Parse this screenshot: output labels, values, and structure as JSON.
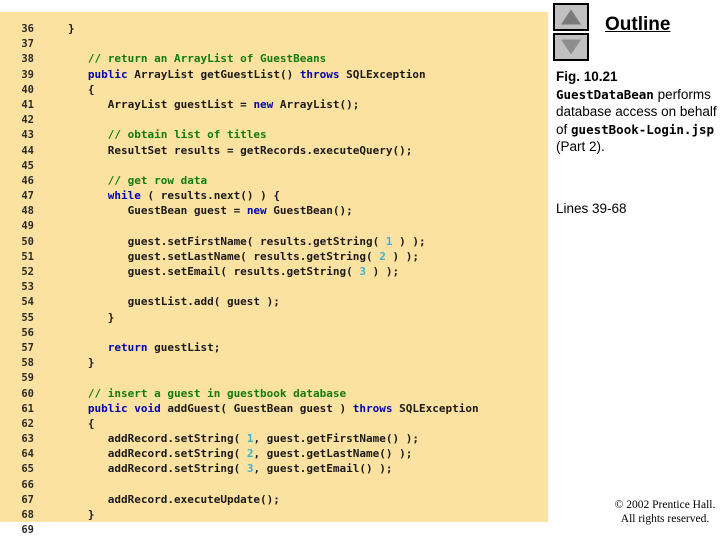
{
  "code_panel": {
    "background_color": "#FCE2A0",
    "lines": [
      {
        "num": "36",
        "tokens": [
          {
            "t": "}",
            "c": "def"
          }
        ]
      },
      {
        "num": "37",
        "tokens": []
      },
      {
        "num": "38",
        "tokens": [
          {
            "t": "   // return an ArrayList of GuestBeans",
            "c": "cmt"
          }
        ]
      },
      {
        "num": "39",
        "tokens": [
          {
            "t": "   ",
            "c": "def"
          },
          {
            "t": "public",
            "c": "kw"
          },
          {
            "t": " ArrayList getGuestList() ",
            "c": "def"
          },
          {
            "t": "throws",
            "c": "kw"
          },
          {
            "t": " SQLException",
            "c": "def"
          }
        ]
      },
      {
        "num": "40",
        "tokens": [
          {
            "t": "   {",
            "c": "def"
          }
        ]
      },
      {
        "num": "41",
        "tokens": [
          {
            "t": "      ArrayList guestList = ",
            "c": "def"
          },
          {
            "t": "new",
            "c": "kw"
          },
          {
            "t": " ArrayList();",
            "c": "def"
          }
        ]
      },
      {
        "num": "42",
        "tokens": []
      },
      {
        "num": "43",
        "tokens": [
          {
            "t": "      // obtain list of titles",
            "c": "cmt"
          }
        ]
      },
      {
        "num": "44",
        "tokens": [
          {
            "t": "      ResultSet results = getRecords.executeQuery();",
            "c": "def"
          }
        ]
      },
      {
        "num": "45",
        "tokens": []
      },
      {
        "num": "46",
        "tokens": [
          {
            "t": "      // get row data",
            "c": "cmt"
          }
        ]
      },
      {
        "num": "47",
        "tokens": [
          {
            "t": "      ",
            "c": "def"
          },
          {
            "t": "while",
            "c": "kw"
          },
          {
            "t": " ( results.next() ) {",
            "c": "def"
          }
        ]
      },
      {
        "num": "48",
        "tokens": [
          {
            "t": "         GuestBean guest = ",
            "c": "def"
          },
          {
            "t": "new",
            "c": "kw"
          },
          {
            "t": " GuestBean();",
            "c": "def"
          }
        ]
      },
      {
        "num": "49",
        "tokens": []
      },
      {
        "num": "50",
        "tokens": [
          {
            "t": "         guest.setFirstName( results.getString( ",
            "c": "def"
          },
          {
            "t": "1",
            "c": "num"
          },
          {
            "t": " ) );",
            "c": "def"
          }
        ]
      },
      {
        "num": "51",
        "tokens": [
          {
            "t": "         guest.setLastName( results.getString( ",
            "c": "def"
          },
          {
            "t": "2",
            "c": "num"
          },
          {
            "t": " ) );",
            "c": "def"
          }
        ]
      },
      {
        "num": "52",
        "tokens": [
          {
            "t": "         guest.setEmail( results.getString( ",
            "c": "def"
          },
          {
            "t": "3",
            "c": "num"
          },
          {
            "t": " ) );",
            "c": "def"
          }
        ]
      },
      {
        "num": "53",
        "tokens": []
      },
      {
        "num": "54",
        "tokens": [
          {
            "t": "         guestList.add( guest );",
            "c": "def"
          }
        ]
      },
      {
        "num": "55",
        "tokens": [
          {
            "t": "      }",
            "c": "def"
          }
        ]
      },
      {
        "num": "56",
        "tokens": []
      },
      {
        "num": "57",
        "tokens": [
          {
            "t": "      ",
            "c": "def"
          },
          {
            "t": "return",
            "c": "kw"
          },
          {
            "t": " guestList;",
            "c": "def"
          }
        ]
      },
      {
        "num": "58",
        "tokens": [
          {
            "t": "   }",
            "c": "def"
          }
        ]
      },
      {
        "num": "59",
        "tokens": []
      },
      {
        "num": "60",
        "tokens": [
          {
            "t": "   // insert a guest in guestbook database",
            "c": "cmt"
          }
        ]
      },
      {
        "num": "61",
        "tokens": [
          {
            "t": "   ",
            "c": "def"
          },
          {
            "t": "public void",
            "c": "kw"
          },
          {
            "t": " addGuest( GuestBean guest ) ",
            "c": "def"
          },
          {
            "t": "throws",
            "c": "kw"
          },
          {
            "t": " SQLException",
            "c": "def"
          }
        ]
      },
      {
        "num": "62",
        "tokens": [
          {
            "t": "   {",
            "c": "def"
          }
        ]
      },
      {
        "num": "63",
        "tokens": [
          {
            "t": "      addRecord.setString( ",
            "c": "def"
          },
          {
            "t": "1",
            "c": "num"
          },
          {
            "t": ", guest.getFirstName() );",
            "c": "def"
          }
        ]
      },
      {
        "num": "64",
        "tokens": [
          {
            "t": "      addRecord.setString( ",
            "c": "def"
          },
          {
            "t": "2",
            "c": "num"
          },
          {
            "t": ", guest.getLastName() );",
            "c": "def"
          }
        ]
      },
      {
        "num": "65",
        "tokens": [
          {
            "t": "      addRecord.setString( ",
            "c": "def"
          },
          {
            "t": "3",
            "c": "num"
          },
          {
            "t": ", guest.getEmail() );",
            "c": "def"
          }
        ]
      },
      {
        "num": "66",
        "tokens": []
      },
      {
        "num": "67",
        "tokens": [
          {
            "t": "      addRecord.executeUpdate();",
            "c": "def"
          }
        ]
      },
      {
        "num": "68",
        "tokens": [
          {
            "t": "   }",
            "c": "def"
          }
        ]
      },
      {
        "num": "69",
        "tokens": []
      }
    ]
  },
  "sidebar": {
    "title": "Outline",
    "scroll_up_icon": "triangle-up-icon",
    "scroll_down_icon": "triangle-down-icon",
    "caption": {
      "figure_number": "Fig. 10.21",
      "code_term_1": "GuestDataBean",
      "text_1": "performs database access on behalf of",
      "code_term_2": "guestBook-Login.jsp",
      "text_2": "(Part 2)."
    },
    "lines_note": "Lines 39-68",
    "copyright_line_1": "© 2002 Prentice Hall.",
    "copyright_line_2": "All rights reserved."
  }
}
